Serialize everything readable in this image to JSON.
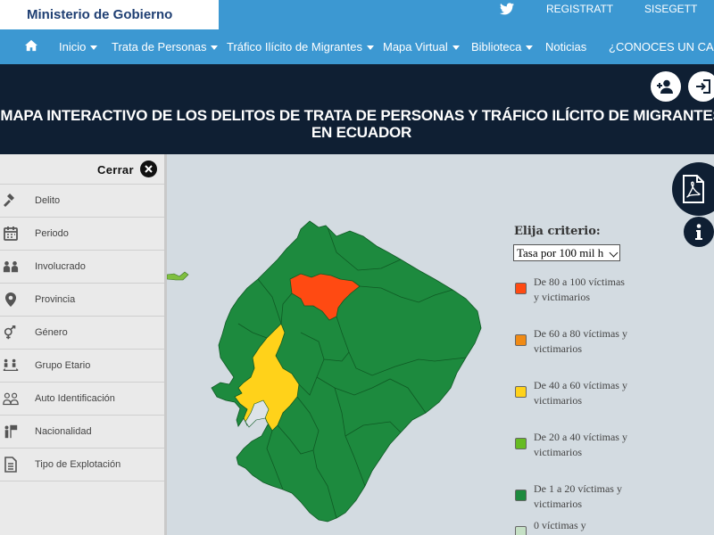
{
  "site": {
    "brand": "Ministerio de Gobierno",
    "top_links": [
      "REGISTRATT",
      "SISEGETT"
    ],
    "twitter_icon": "twitter-icon"
  },
  "nav": {
    "home_icon": "home-icon",
    "items": [
      {
        "label": "Inicio",
        "dropdown": true
      },
      {
        "label": "Trata de Personas",
        "dropdown": true
      },
      {
        "label": "Tráfico Ilícito de Migrantes",
        "dropdown": true
      },
      {
        "label": "Mapa Virtual",
        "dropdown": true
      },
      {
        "label": "Biblioteca",
        "dropdown": true
      },
      {
        "label": "Noticias",
        "dropdown": false
      },
      {
        "label": "¿CONOCES UN CASO",
        "dropdown": false
      }
    ]
  },
  "header": {
    "title": "MAPA INTERACTIVO DE LOS DELITOS DE TRATA DE PERSONAS Y TRÁFICO ILÍCITO DE MIGRANTES EN ECUADOR",
    "buttons": [
      "add-user-icon",
      "login-icon"
    ]
  },
  "panel": {
    "close_label": "Cerrar",
    "filters": [
      {
        "label": "Delito",
        "icon": "gavel-icon"
      },
      {
        "label": "Periodo",
        "icon": "calendar-icon"
      },
      {
        "label": "Involucrado",
        "icon": "people-icon"
      },
      {
        "label": "Provincia",
        "icon": "map-pin-icon"
      },
      {
        "label": "Género",
        "icon": "gender-icon"
      },
      {
        "label": "Grupo Etario",
        "icon": "age-group-icon"
      },
      {
        "label": "Auto Identificación",
        "icon": "self-identification-icon"
      },
      {
        "label": "Nacionalidad",
        "icon": "nationality-icon"
      },
      {
        "label": "Tipo de Explotación",
        "icon": "document-icon"
      }
    ]
  },
  "map": {
    "title": "Elija criterio:",
    "criteria_selected": "Tasa por 100 mil h",
    "legend": [
      {
        "label": "De 80 a 100 víctimas y victimarios",
        "color": "#ff4a12"
      },
      {
        "label": "De 60 a 80 víctimas y victimarios",
        "color": "#f08a14"
      },
      {
        "label": "De 40 a 60 víctimas y victimarios",
        "color": "#ffd21a"
      },
      {
        "label": "De 20 a 40 víctimas y victimarios",
        "color": "#66bb22"
      },
      {
        "label": "De 1 a 20 víctimas y victimarios",
        "color": "#1d8a3e"
      },
      {
        "label": "0 víctimas y",
        "color": "#c5e0c5"
      }
    ],
    "colors": {
      "green": "#1d8a3e",
      "yellow": "#ffd21a",
      "red": "#ff4a12",
      "light_green": "#7fbf3f",
      "water": "#dde3e8"
    }
  },
  "floating": {
    "pdf_icon": "pdf-icon",
    "info_icon": "info-icon"
  }
}
